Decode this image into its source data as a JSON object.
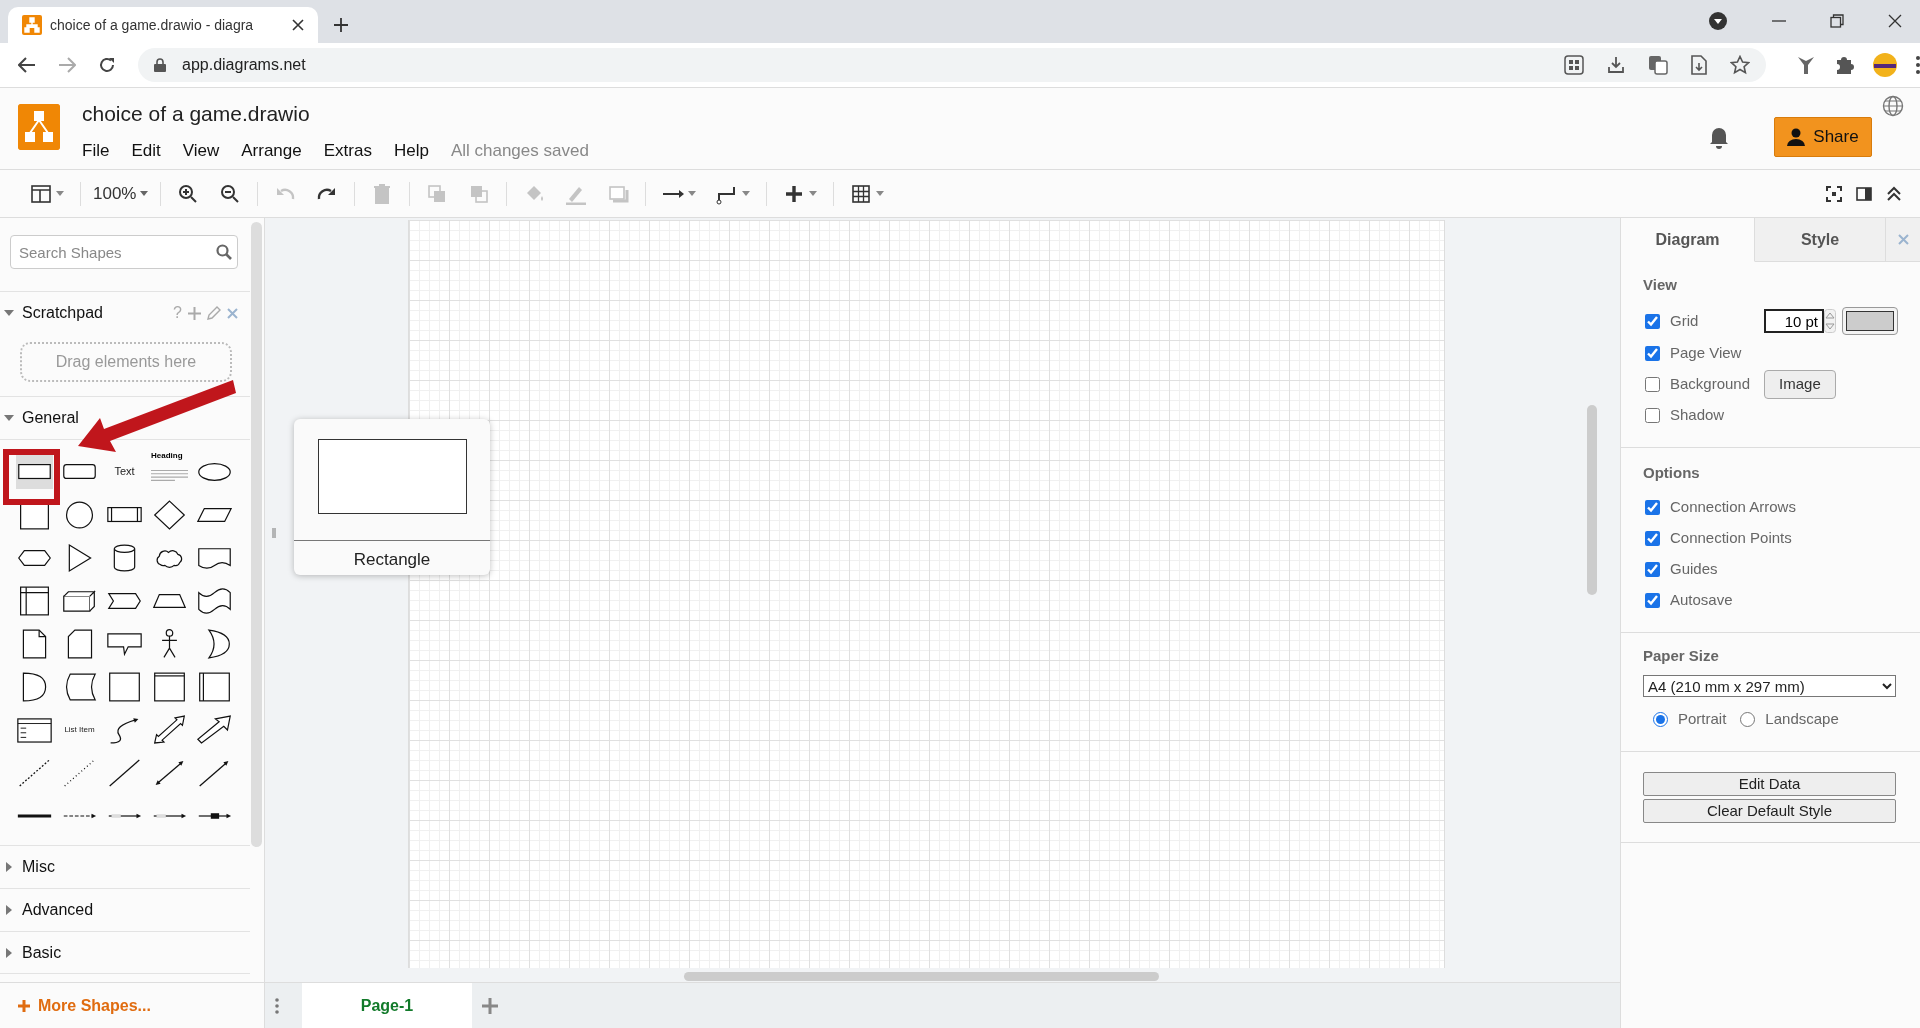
{
  "browser": {
    "tab_title": "choice of a game.drawio - diagra",
    "url": "app.diagrams.net"
  },
  "app": {
    "title": "choice of a game.drawio",
    "menus": [
      "File",
      "Edit",
      "View",
      "Arrange",
      "Extras",
      "Help"
    ],
    "save_status": "All changes saved",
    "share_label": "Share"
  },
  "toolbar": {
    "zoom": "100%",
    "items": [
      {
        "kind": "format",
        "disabled": false
      },
      {
        "kind": "zoom-in",
        "disabled": false
      },
      {
        "kind": "zoom-out",
        "disabled": false
      },
      {
        "kind": "undo",
        "disabled": true
      },
      {
        "kind": "redo",
        "disabled": false
      },
      {
        "kind": "delete",
        "disabled": true
      },
      {
        "kind": "to-front",
        "disabled": true
      },
      {
        "kind": "to-back",
        "disabled": true
      },
      {
        "kind": "fill",
        "disabled": true
      },
      {
        "kind": "line-color",
        "disabled": true
      },
      {
        "kind": "shadow",
        "disabled": true
      },
      {
        "kind": "connection",
        "disabled": false
      },
      {
        "kind": "waypoints",
        "disabled": false
      },
      {
        "kind": "insert",
        "disabled": false
      },
      {
        "kind": "table",
        "disabled": false
      }
    ]
  },
  "sidebar": {
    "search_placeholder": "Search Shapes",
    "scratchpad": {
      "title": "Scratchpad",
      "expanded": true,
      "help": "?",
      "hint": "Drag elements here"
    },
    "general": {
      "title": "General",
      "expanded": true,
      "shapes": [
        {
          "kind": "rect",
          "selected": true
        },
        {
          "kind": "rounded",
          "selected": false
        },
        {
          "kind": "text",
          "label": "Text",
          "selected": false
        },
        {
          "kind": "heading",
          "label": "Heading",
          "selected": false
        },
        {
          "kind": "ellipse",
          "selected": false
        },
        {
          "kind": "square",
          "selected": false
        },
        {
          "kind": "circle",
          "selected": false
        },
        {
          "kind": "process",
          "selected": false
        },
        {
          "kind": "diamond",
          "selected": false
        },
        {
          "kind": "parallelogram",
          "selected": false
        },
        {
          "kind": "hexagon",
          "selected": false
        },
        {
          "kind": "triangle",
          "selected": false
        },
        {
          "kind": "cylinder",
          "selected": false
        },
        {
          "kind": "cloud",
          "selected": false
        },
        {
          "kind": "document",
          "selected": false
        },
        {
          "kind": "internal-storage",
          "selected": false
        },
        {
          "kind": "cube",
          "selected": false
        },
        {
          "kind": "step",
          "selected": false
        },
        {
          "kind": "trapezoid",
          "selected": false
        },
        {
          "kind": "tape",
          "selected": false
        },
        {
          "kind": "note",
          "selected": false
        },
        {
          "kind": "card",
          "selected": false
        },
        {
          "kind": "callout",
          "selected": false
        },
        {
          "kind": "actor",
          "selected": false
        },
        {
          "kind": "or",
          "selected": false
        },
        {
          "kind": "and",
          "selected": false
        },
        {
          "kind": "data-storage",
          "selected": false
        },
        {
          "kind": "container",
          "selected": false
        },
        {
          "kind": "swimlane",
          "selected": false
        },
        {
          "kind": "side-lane",
          "selected": false
        },
        {
          "kind": "list",
          "selected": false
        },
        {
          "kind": "list-item",
          "label": "List Item",
          "selected": false
        },
        {
          "kind": "curve",
          "selected": false
        },
        {
          "kind": "double-block-arrow",
          "selected": false
        },
        {
          "kind": "block-arrow",
          "selected": false
        },
        {
          "kind": "dashed-line",
          "selected": false
        },
        {
          "kind": "dotted-line",
          "selected": false
        },
        {
          "kind": "line",
          "selected": false
        },
        {
          "kind": "double-arrow",
          "selected": false
        },
        {
          "kind": "arrow",
          "selected": false
        },
        {
          "kind": "thick-line",
          "selected": false
        },
        {
          "kind": "dashed-arrow",
          "selected": false
        },
        {
          "kind": "label-arrow",
          "selected": false
        },
        {
          "kind": "label-arrow",
          "selected": false
        },
        {
          "kind": "box-arrow",
          "selected": false
        }
      ]
    },
    "sections": [
      {
        "title": "Misc",
        "expanded": false
      },
      {
        "title": "Advanced",
        "expanded": false
      },
      {
        "title": "Basic",
        "expanded": false
      }
    ],
    "more_shapes": "More Shapes..."
  },
  "tooltip": {
    "label": "Rectangle"
  },
  "pages": [
    {
      "label": "Page-1",
      "selected": true
    }
  ],
  "format_panel": {
    "tabs": [
      {
        "label": "Diagram",
        "selected": true
      },
      {
        "label": "Style",
        "selected": false
      }
    ],
    "view": {
      "title": "View",
      "options": [
        {
          "kind": "grid",
          "label": "Grid",
          "checked": true,
          "value": "10 pt"
        },
        {
          "kind": "plain",
          "label": "Page View",
          "checked": true
        },
        {
          "kind": "background",
          "label": "Background",
          "checked": false,
          "button": "Image"
        },
        {
          "kind": "plain",
          "label": "Shadow",
          "checked": false
        }
      ]
    },
    "options": {
      "title": "Options",
      "items": [
        {
          "label": "Connection Arrows",
          "checked": true
        },
        {
          "label": "Connection Points",
          "checked": true
        },
        {
          "label": "Guides",
          "checked": true
        },
        {
          "label": "Autosave",
          "checked": true
        }
      ]
    },
    "paper": {
      "title": "Paper Size",
      "value": "A4 (210 mm x 297 mm)",
      "orientations": [
        {
          "label": "Portrait",
          "selected": true
        },
        {
          "label": "Landscape",
          "selected": false
        }
      ]
    },
    "buttons": [
      "Edit Data",
      "Clear Default Style"
    ]
  }
}
